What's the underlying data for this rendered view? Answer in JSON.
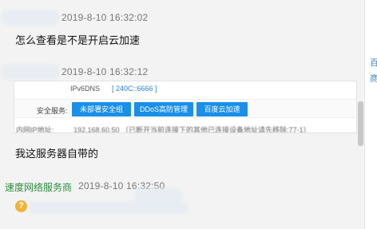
{
  "messages": [
    {
      "time": "2019-8-10 16:32:02",
      "text": "怎么查看是不是开启云加速"
    },
    {
      "time": "2019-8-10 16:32:12",
      "text": "我这服务器自带的"
    },
    {
      "sender": "速度网络服务商",
      "time": "2019-8-10 16:32:50"
    }
  ],
  "screenshot": {
    "dns_label": "IPv6DNS",
    "dns_value": "[ 240C::6666 ]",
    "security_label": "安全服务:",
    "buttons": [
      "未部署安全组",
      "DDoS高防管理",
      "百度云加速"
    ],
    "ip_label": "内网IP地址:",
    "ip_value": "192.168.60.50 （已断开当前连接下的其他已连接设备地址请先移除:77-1）"
  },
  "right_panel": {
    "links": [
      "百",
      "商"
    ]
  },
  "avatar_glyph": "?",
  "colors": {
    "accent_blue": "#1a8fe8",
    "sender_green": "#2a8c3d",
    "background": "#f3f3f3"
  }
}
